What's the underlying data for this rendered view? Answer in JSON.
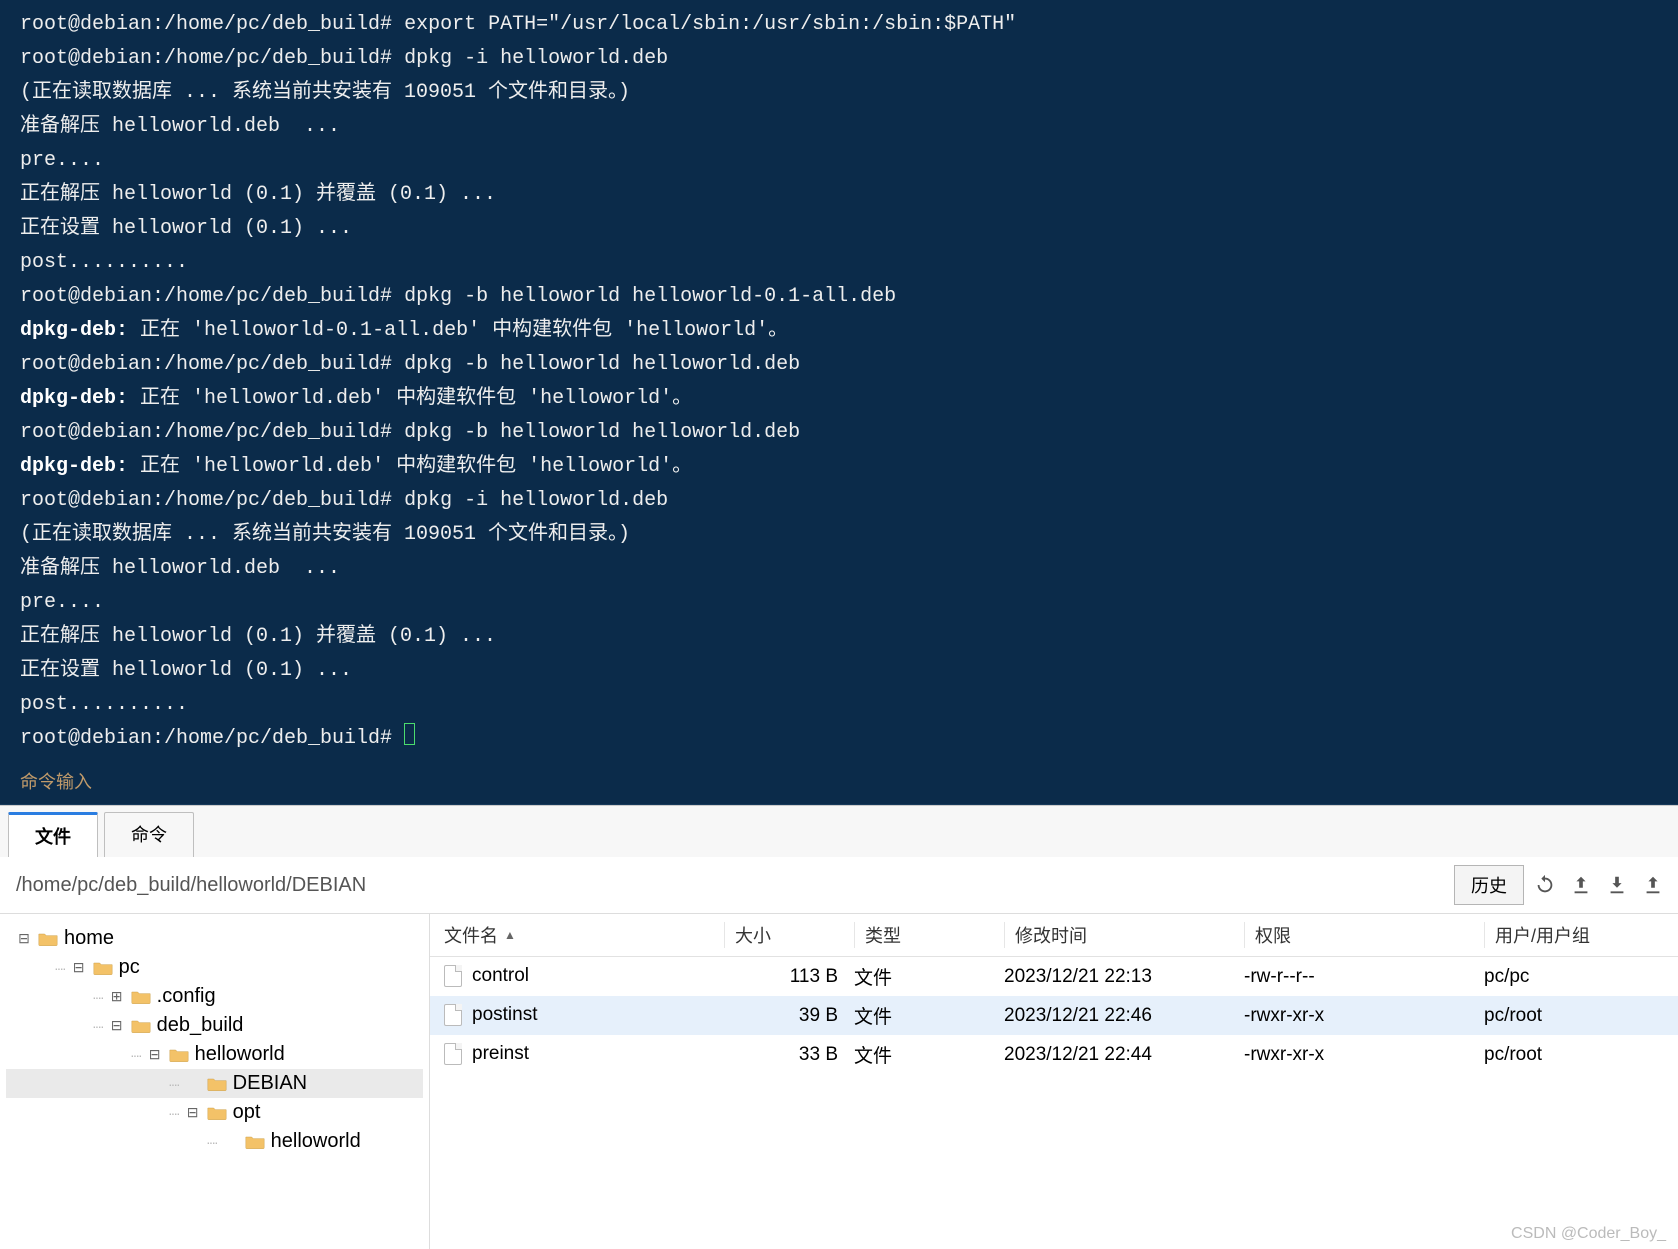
{
  "terminal": {
    "lines": [
      "root@debian:/home/pc/deb_build# export PATH=\"/usr/local/sbin:/usr/sbin:/sbin:$PATH\"",
      "root@debian:/home/pc/deb_build# dpkg -i helloworld.deb",
      "(正在读取数据库 ... 系统当前共安装有 109051 个文件和目录。)",
      "准备解压 helloworld.deb  ...",
      "pre....",
      "正在解压 helloworld (0.1) 并覆盖 (0.1) ...",
      "正在设置 helloworld (0.1) ...",
      "post..........",
      "root@debian:/home/pc/deb_build# dpkg -b helloworld helloworld-0.1-all.deb",
      "dpkg-deb: 正在 'helloworld-0.1-all.deb' 中构建软件包 'helloworld'。",
      "root@debian:/home/pc/deb_build# dpkg -b helloworld helloworld.deb",
      "dpkg-deb: 正在 'helloworld.deb' 中构建软件包 'helloworld'。",
      "root@debian:/home/pc/deb_build# dpkg -b helloworld helloworld.deb",
      "dpkg-deb: 正在 'helloworld.deb' 中构建软件包 'helloworld'。",
      "root@debian:/home/pc/deb_build# dpkg -i helloworld.deb",
      "(正在读取数据库 ... 系统当前共安装有 109051 个文件和目录。)",
      "准备解压 helloworld.deb  ...",
      "pre....",
      "正在解压 helloworld (0.1) 并覆盖 (0.1) ...",
      "正在设置 helloworld (0.1) ...",
      "post..........",
      "root@debian:/home/pc/deb_build# "
    ],
    "bold_prefixes": [
      "dpkg-deb:"
    ],
    "cmd_input_label": "命令输入"
  },
  "tabs": {
    "file": "文件",
    "cmd": "命令"
  },
  "pathbar": {
    "path": "/home/pc/deb_build/helloworld/DEBIAN",
    "history": "历史"
  },
  "tree": [
    {
      "depth": 0,
      "expander": "⊟",
      "label": "home"
    },
    {
      "depth": 1,
      "expander": "⊟",
      "label": "pc"
    },
    {
      "depth": 2,
      "expander": "⊞",
      "label": ".config"
    },
    {
      "depth": 2,
      "expander": "⊟",
      "label": "deb_build"
    },
    {
      "depth": 3,
      "expander": "⊟",
      "label": "helloworld"
    },
    {
      "depth": 4,
      "expander": "",
      "label": "DEBIAN",
      "selected": true
    },
    {
      "depth": 4,
      "expander": "⊟",
      "label": "opt"
    },
    {
      "depth": 5,
      "expander": "",
      "label": "helloworld"
    }
  ],
  "list": {
    "headers": {
      "name": "文件名",
      "size": "大小",
      "type": "类型",
      "mtime": "修改时间",
      "perm": "权限",
      "owner": "用户/用户组"
    },
    "rows": [
      {
        "name": "control",
        "size": "113 B",
        "type": "文件",
        "mtime": "2023/12/21 22:13",
        "perm": "-rw-r--r--",
        "owner": "pc/pc"
      },
      {
        "name": "postinst",
        "size": "39 B",
        "type": "文件",
        "mtime": "2023/12/21 22:46",
        "perm": "-rwxr-xr-x",
        "owner": "pc/root",
        "selected": true
      },
      {
        "name": "preinst",
        "size": "33 B",
        "type": "文件",
        "mtime": "2023/12/21 22:44",
        "perm": "-rwxr-xr-x",
        "owner": "pc/root"
      }
    ]
  },
  "watermark": "CSDN @Coder_Boy_"
}
